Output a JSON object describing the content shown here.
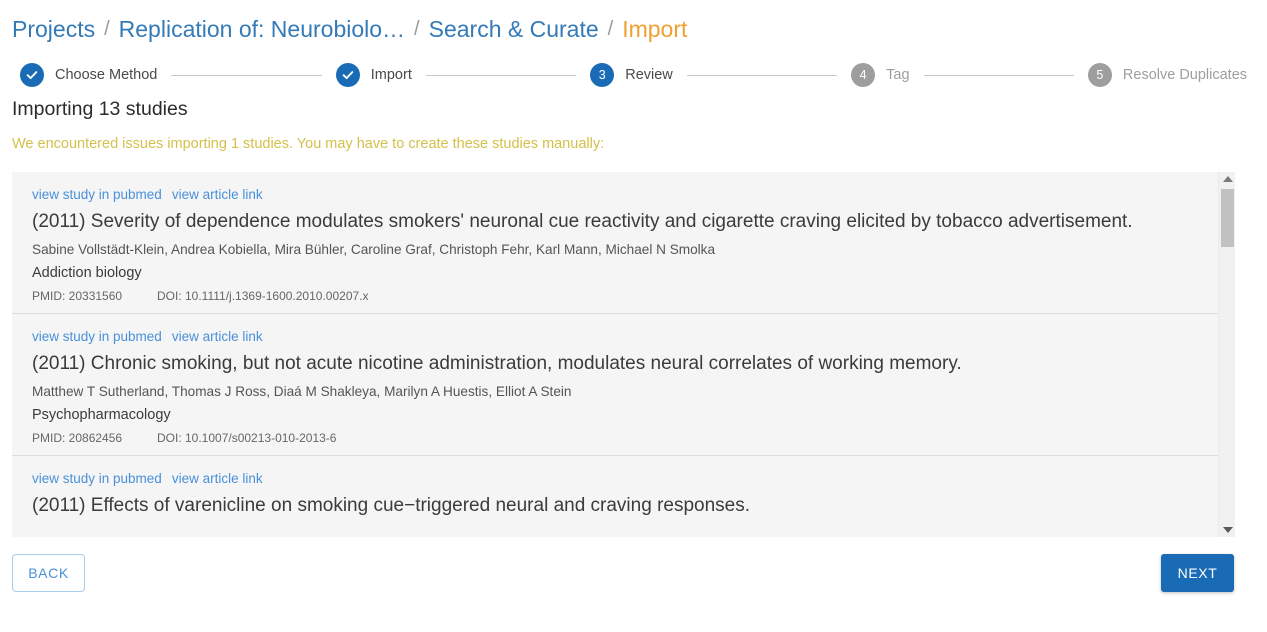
{
  "breadcrumb": {
    "separator": "/",
    "items": [
      {
        "label": "Projects",
        "current": false
      },
      {
        "label": "Replication of: Neurobiolo…",
        "current": false
      },
      {
        "label": "Search & Curate",
        "current": false
      },
      {
        "label": "Import",
        "current": true
      }
    ]
  },
  "stepper": {
    "steps": [
      {
        "number": "1",
        "label": "Choose Method",
        "state": "done",
        "icon": "check-icon"
      },
      {
        "number": "2",
        "label": "Import",
        "state": "done",
        "icon": "check-icon"
      },
      {
        "number": "3",
        "label": "Review",
        "state": "active",
        "icon": ""
      },
      {
        "number": "4",
        "label": "Tag",
        "state": "todo",
        "icon": ""
      },
      {
        "number": "5",
        "label": "Resolve Duplicates",
        "state": "todo",
        "icon": ""
      }
    ]
  },
  "heading": "Importing 13 studies",
  "warning": "We encountered issues importing 1 studies. You may have to create these studies manually:",
  "colors": {
    "accent_blue": "#1a6bb5",
    "link_blue": "#4a90d9",
    "breadcrumb_blue": "#337ab7",
    "current_crumb_orange": "#f0a030",
    "warning_yellow": "#d4c04a",
    "panel_bg": "#f5f5f5",
    "step_todo_grey": "#9e9e9e"
  },
  "studies": [
    {
      "link_pubmed": "view study in pubmed",
      "link_article": "view article link",
      "title": "(2011) Severity of dependence modulates smokers' neuronal cue reactivity and cigarette craving elicited by tobacco advertisement.",
      "authors": "Sabine Vollstädt-Klein, Andrea Kobiella, Mira Bühler, Caroline Graf, Christoph Fehr, Karl Mann, Michael N Smolka",
      "journal": "Addiction biology",
      "pmid": "PMID: 20331560",
      "doi": "DOI: 10.1111/j.1369-1600.2010.00207.x"
    },
    {
      "link_pubmed": "view study in pubmed",
      "link_article": "view article link",
      "title": "(2011) Chronic smoking, but not acute nicotine administration, modulates neural correlates of working memory.",
      "authors": "Matthew T Sutherland, Thomas J Ross, Diaá M Shakleya, Marilyn A Huestis, Elliot A Stein",
      "journal": "Psychopharmacology",
      "pmid": "PMID: 20862456",
      "doi": "DOI: 10.1007/s00213-010-2013-6"
    },
    {
      "link_pubmed": "view study in pubmed",
      "link_article": "view article link",
      "title": "(2011) Effects of varenicline on smoking cue−triggered neural and craving responses.",
      "authors": "",
      "journal": "",
      "pmid": "",
      "doi": ""
    }
  ],
  "footer": {
    "back_label": "BACK",
    "next_label": "NEXT"
  },
  "scrollbar": {
    "up_icon": "triangle-up-icon",
    "down_icon": "triangle-down-icon",
    "thumb": "scrollbar-thumb"
  }
}
